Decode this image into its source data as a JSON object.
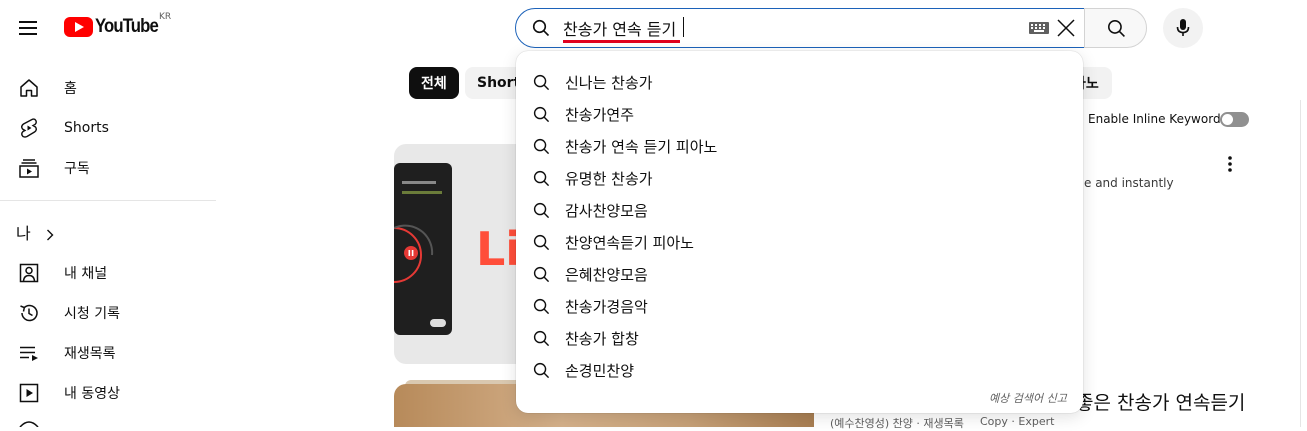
{
  "header": {
    "logo_text": "YouTube",
    "country_code": "KR",
    "search_value": "찬송가 연속 듣기",
    "icons": [
      "menu-icon",
      "search-icon",
      "keyboard-icon",
      "clear-icon",
      "microphone-icon"
    ]
  },
  "sidebar": {
    "items": [
      {
        "label": "홈",
        "icon": "home-icon"
      },
      {
        "label": "Shorts",
        "icon": "shorts-icon"
      },
      {
        "label": "구독",
        "icon": "subscriptions-icon"
      }
    ],
    "me_label": "나",
    "me_items": [
      {
        "label": "내 채널",
        "icon": "channel-icon"
      },
      {
        "label": "시청 기록",
        "icon": "history-icon"
      },
      {
        "label": "재생목록",
        "icon": "playlist-icon"
      },
      {
        "label": "내 동영상",
        "icon": "my-videos-icon"
      }
    ]
  },
  "chips": [
    "전체",
    "Shorts",
    "아노"
  ],
  "inline_keywords": {
    "label": "Enable Inline Keywords",
    "enabled": false
  },
  "suggestions": [
    "신나는 찬송가",
    "찬송가연주",
    "찬송가 연속 듣기 피아노",
    "유명한 찬송가",
    "감사찬양모음",
    "찬양연속듣기 피아노",
    "은혜찬양모음",
    "찬송가경음악",
    "찬송가 합창",
    "손경민찬양"
  ],
  "report_label": "예상 검색어 신고",
  "results": [
    {
      "thumb_text": "Li",
      "desc": "e and instantly"
    },
    {
      "title": "좋은 찬송가 연속듣기",
      "meta": "(예수찬영성) 찬양 · 재생목록",
      "meta_right": "Copy · Expert"
    }
  ],
  "colors": {
    "accent": "#1c62b9",
    "brand": "#ff0000",
    "underline": "#e1001f"
  }
}
